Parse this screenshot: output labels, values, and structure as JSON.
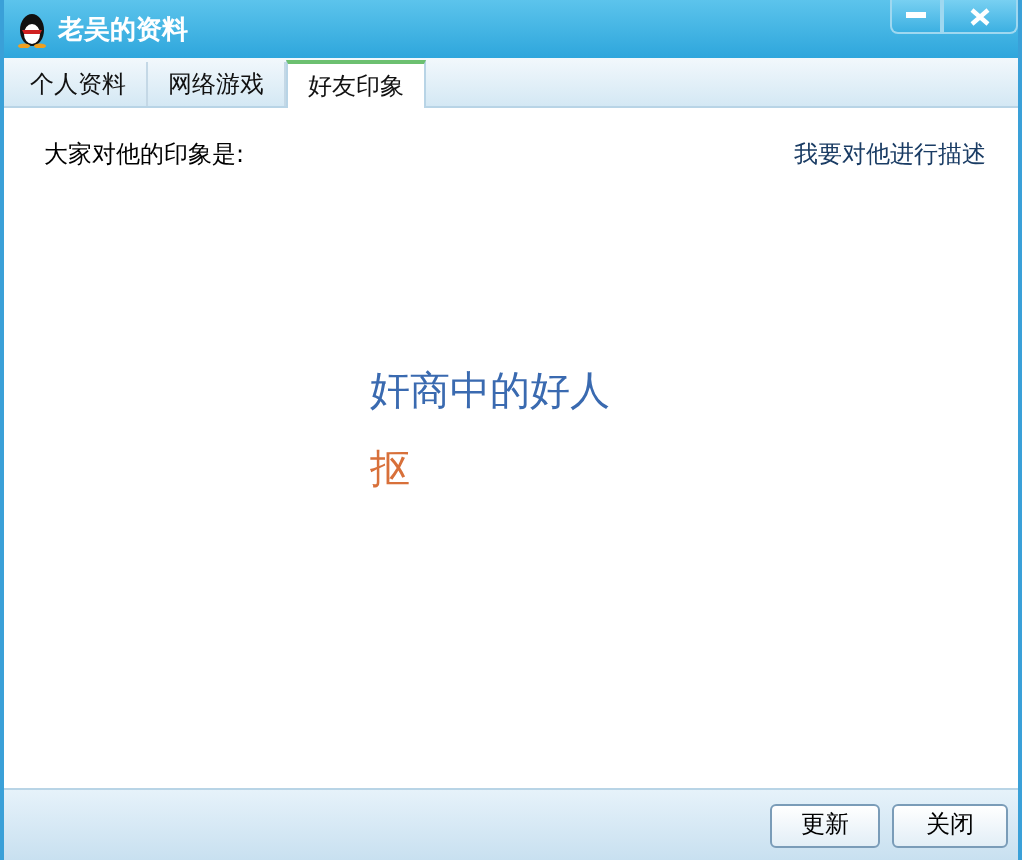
{
  "window": {
    "title": "老吴的资料"
  },
  "tabs": [
    {
      "label": "个人资料",
      "selected": false
    },
    {
      "label": "网络游戏",
      "selected": false
    },
    {
      "label": "好友印象",
      "selected": true
    }
  ],
  "impressions_heading": "大家对他的印象是:",
  "describe_link": "我要对他进行描述",
  "impressions": [
    {
      "text": "奸商中的好人",
      "color": "#3a6ab0"
    },
    {
      "text": "抠",
      "color": "#d8703a"
    }
  ],
  "buttons": [
    "更新",
    "关闭"
  ]
}
